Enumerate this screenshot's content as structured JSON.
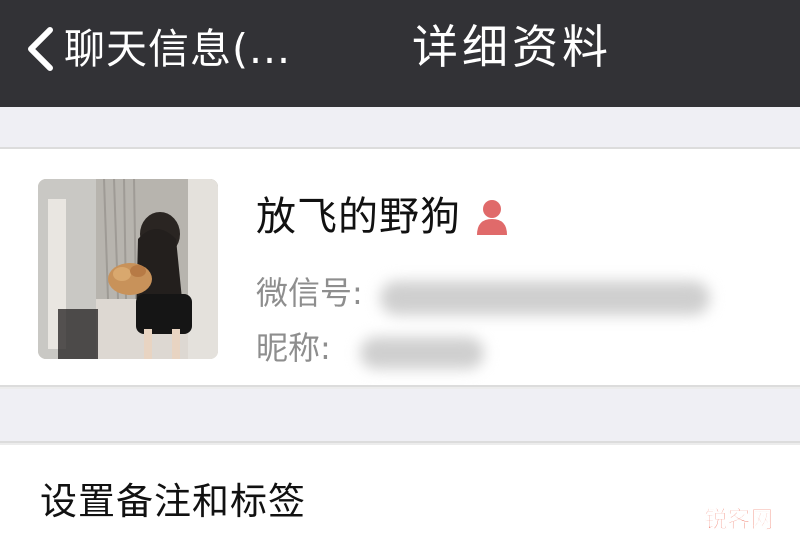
{
  "navbar": {
    "back_label": "聊天信息(...",
    "title": "详细资料",
    "back_icon": "chevron-left-icon",
    "background": "#323236"
  },
  "profile": {
    "nickname": "放飞的野狗",
    "gender_icon": "female-user-icon",
    "gender_color": "#e06a6a",
    "wechat_id_label": "微信号:",
    "remark_label": "昵称:"
  },
  "settings": {
    "remark_tags_label": "设置备注和标签"
  },
  "watermark": {
    "text": "锐客网",
    "color": "#e8442c"
  }
}
